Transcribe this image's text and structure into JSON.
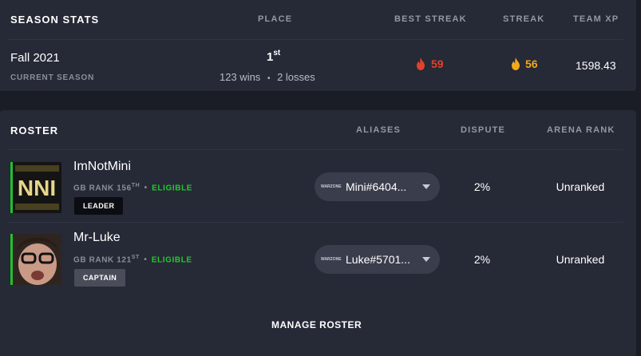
{
  "season": {
    "title": "SEASON STATS",
    "columns": {
      "place": "PLACE",
      "best_streak": "BEST STREAK",
      "streak": "STREAK",
      "team_xp": "TEAM XP"
    },
    "name": "Fall 2021",
    "label": "CURRENT SEASON",
    "place": "1",
    "place_suffix": "st",
    "wins": "123 wins",
    "separator": "•",
    "losses": "2 losses",
    "best_streak": "59",
    "streak": "56",
    "team_xp": "1598.43",
    "colors": {
      "best_streak": "#e0422a",
      "streak": "#f2a81d"
    }
  },
  "roster": {
    "title": "ROSTER",
    "columns": {
      "aliases": "ALIASES",
      "dispute": "DISPUTE",
      "arena_rank": "ARENA RANK"
    },
    "members": [
      {
        "name": "ImNotMini",
        "rank_prefix": "GB RANK 156",
        "rank_suffix": "TH",
        "dot": "•",
        "status": "ELIGIBLE",
        "role": "LEADER",
        "alias_logo": "WARZONE",
        "alias": "Mini#6404...",
        "dispute": "2%",
        "arena_rank": "Unranked",
        "avatar_text": "NNI"
      },
      {
        "name": "Mr-Luke",
        "rank_prefix": "GB RANK 121",
        "rank_suffix": "ST",
        "dot": "•",
        "status": "ELIGIBLE",
        "role": "CAPTAIN",
        "alias_logo": "WARZONE",
        "alias": "Luke#5701...",
        "dispute": "2%",
        "arena_rank": "Unranked"
      }
    ],
    "manage_label": "MANAGE ROSTER"
  }
}
